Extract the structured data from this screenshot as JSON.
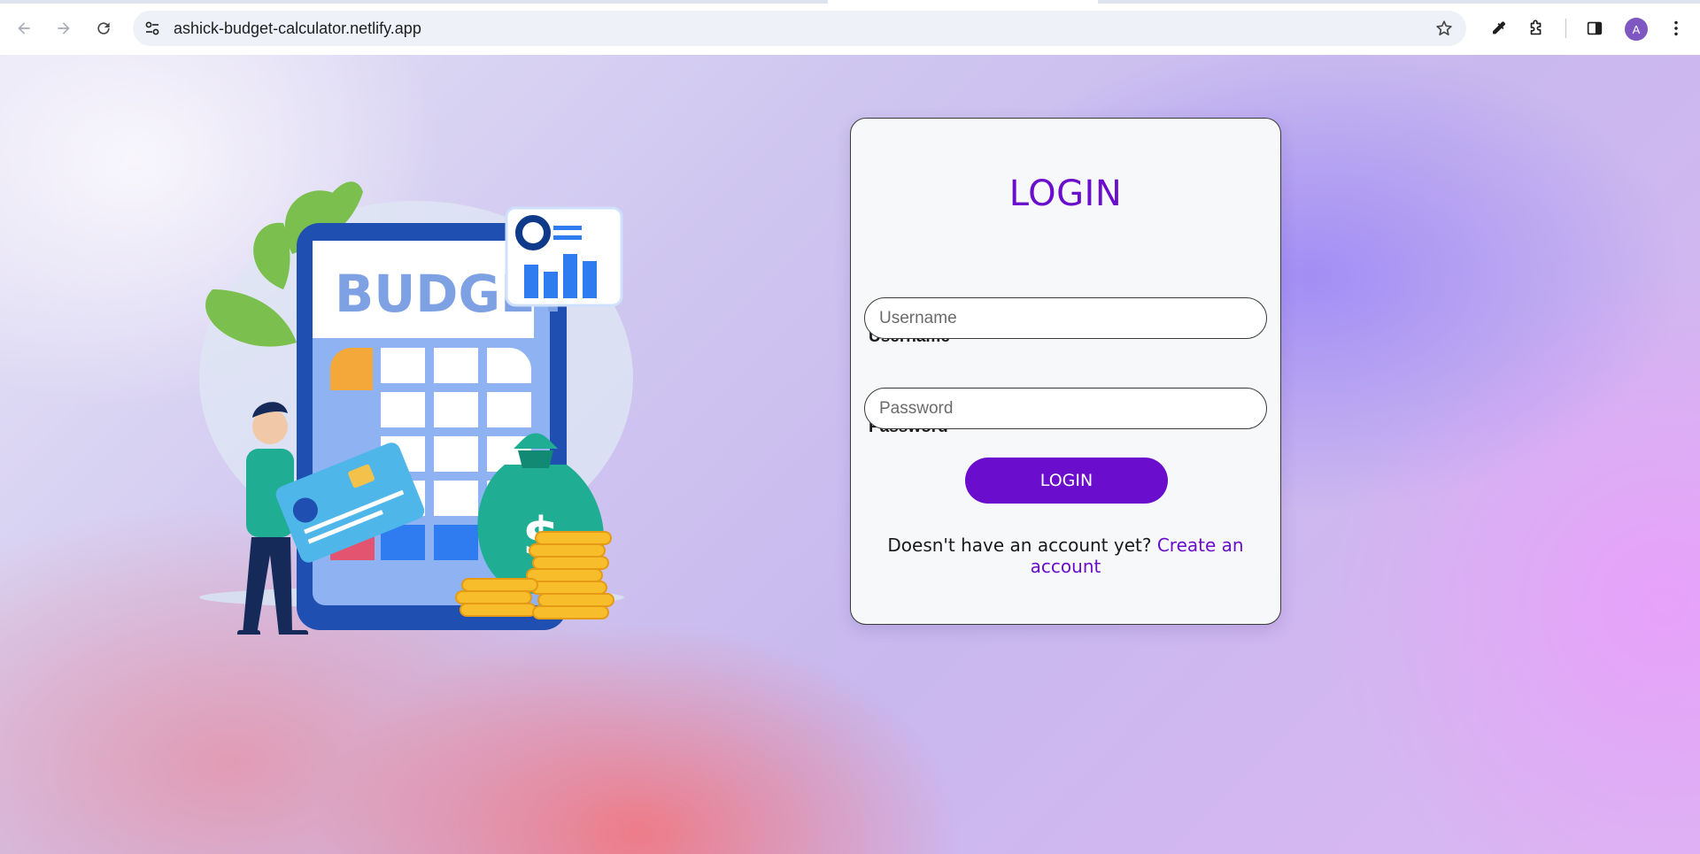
{
  "browser": {
    "url": "ashick-budget-calculator.netlify.app",
    "avatar_letter": "A",
    "icons": {
      "back": "back-arrow-icon",
      "forward": "forward-arrow-icon",
      "reload": "reload-icon",
      "site_info": "site-settings-icon",
      "bookmark": "star-icon",
      "eyedropper": "eyedropper-icon",
      "extensions": "puzzle-icon",
      "side_panel": "side-panel-icon",
      "menu": "kebab-menu-icon"
    }
  },
  "illustration": {
    "caption_text": "BUDGET",
    "icon": "budget-calculator-illustration"
  },
  "login": {
    "title": "LOGIN",
    "username_label": "Username",
    "username_placeholder": "Username",
    "password_label": "Password",
    "password_placeholder": "Password",
    "button_label": "LOGIN",
    "signup_prompt": "Doesn't have an account yet?",
    "signup_link": "Create an account"
  },
  "colors": {
    "accent": "#6a0dcc",
    "card_bg": "#f7f8fa"
  }
}
